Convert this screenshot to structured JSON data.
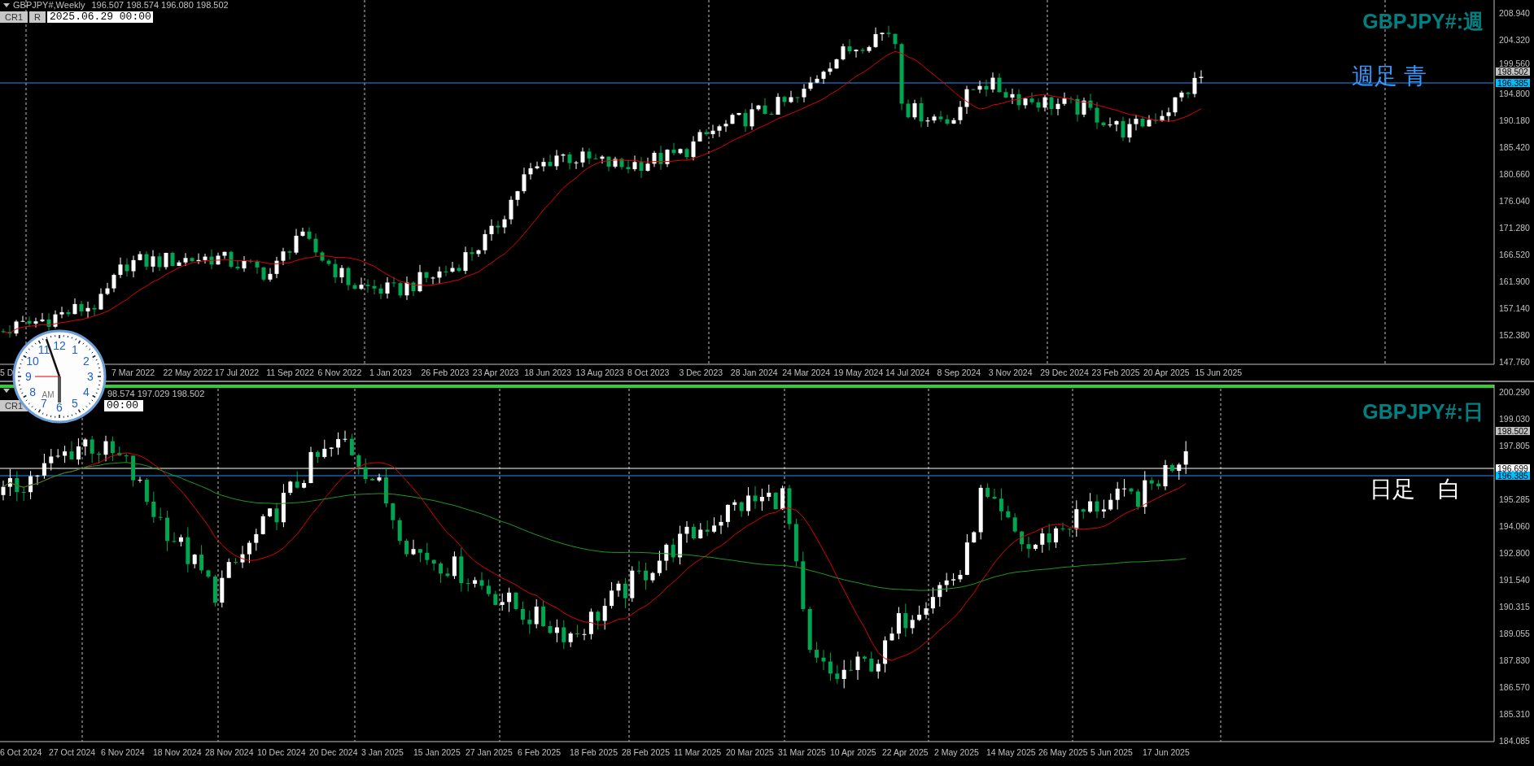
{
  "weekly_chart": {
    "header": {
      "symbol": "GBPJPY#,Weekly",
      "ohlc": "196.507 198.574 196.080 198.502"
    },
    "toolbar": {
      "buttons": [
        "CR1",
        "R"
      ],
      "time_field": "2025.06.29 00:00"
    },
    "title": "GBPJPY#:週",
    "note": "週足 青",
    "price_axis": [
      "208.940",
      "204.320",
      "199.560",
      "194.800",
      "190.180",
      "185.420",
      "180.660",
      "176.040",
      "171.280",
      "166.520",
      "161.900",
      "157.140",
      "152.380",
      "147.760"
    ],
    "price_tags": [
      {
        "value": "198.502",
        "color": "#c0c0c0"
      },
      {
        "value": "196.385",
        "color": "#00bfff"
      }
    ],
    "time_axis": [
      "5 D",
      "7 Mar 2022",
      "22 May 2022",
      "17 Jul 2022",
      "11 Sep 2022",
      "6 Nov 2022",
      "1 Jan 2023",
      "26 Feb 2023",
      "23 Apr 2023",
      "18 Jun 2023",
      "13 Aug 2023",
      "8 Oct 2023",
      "3 Dec 2023",
      "28 Jan 2024",
      "24 Mar 2024",
      "19 May 2024",
      "14 Jul 2024",
      "8 Sep 2024",
      "3 Nov 2024",
      "29 Dec 2024",
      "23 Feb 2025",
      "20 Apr 2025",
      "15 Jun 2025"
    ]
  },
  "daily_chart": {
    "header": {
      "ohlc": "98.574 197.029 198.502"
    },
    "toolbar": {
      "buttons": [
        "CR1"
      ],
      "time_field": "00:00"
    },
    "title": "GBPJPY#:日",
    "note": "日足　白",
    "price_axis": [
      "200.290",
      "199.030",
      "197.805",
      "195.285",
      "194.060",
      "192.800",
      "191.540",
      "190.315",
      "189.055",
      "187.830",
      "186.570",
      "185.310",
      "184.085"
    ],
    "price_tags": [
      {
        "value": "198.502",
        "color": "#c0c0c0"
      },
      {
        "value": "196.699",
        "color": "#ffffff"
      },
      {
        "value": "196.385",
        "color": "#00bfff"
      }
    ],
    "time_axis": [
      "6 Oct 2024",
      "27 Oct 2024",
      "6 Nov 2024",
      "18 Nov 2024",
      "28 Nov 2024",
      "10 Dec 2024",
      "20 Dec 2024",
      "3 Jan 2025",
      "15 Jan 2025",
      "27 Jan 2025",
      "6 Feb 2025",
      "18 Feb 2025",
      "28 Feb 2025",
      "11 Mar 2025",
      "20 Mar 2025",
      "31 Mar 2025",
      "10 Apr 2025",
      "22 Apr 2025",
      "2 May 2025",
      "14 May 2025",
      "26 May 2025",
      "5 Jun 2025",
      "17 Jun 2025"
    ]
  },
  "clock": {
    "numerals": [
      "12",
      "11",
      "1",
      "10",
      "2",
      "9",
      "3",
      "8",
      "4",
      "7",
      "5",
      "6"
    ],
    "period": "AM"
  }
}
